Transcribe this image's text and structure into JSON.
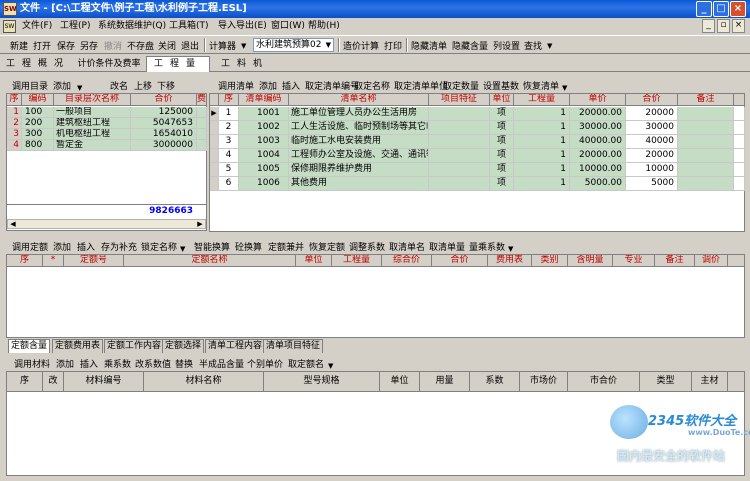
{
  "title": "文件 - [C:\\工程文件\\例子工程\\水利例子工程.ESL]",
  "menu": [
    "文件(F)",
    "工程(P)",
    "系统数据维护(Q)",
    "工具箱(T)",
    "导入导出(E)",
    "窗口(W)",
    "帮助(H)"
  ],
  "toolbar": {
    "items": [
      "新建",
      "打开",
      "保存",
      "另存",
      "撤消",
      "不存盘",
      "关闭",
      "退出",
      "计算器",
      "水利建筑预算02",
      "造价计算",
      "打印",
      "隐藏清单",
      "隐藏含量",
      "列设置",
      "查找"
    ],
    "disabled": [
      "撤消"
    ]
  },
  "tabs": [
    "工程概况",
    "计价条件及费率",
    "工程量",
    "工料机"
  ],
  "active_tab": "工程量",
  "left_toolbar": [
    "调用目录",
    "添加",
    "改名",
    "上移",
    "下移"
  ],
  "left_headers": [
    "序",
    "编码",
    "目录层次名称",
    "合价",
    "费"
  ],
  "left_rows": [
    {
      "seq": "1",
      "code": "100",
      "name": "一般项目",
      "price": "125000"
    },
    {
      "seq": "2",
      "code": "200",
      "name": "建筑枢纽工程",
      "price": "5047653"
    },
    {
      "seq": "3",
      "code": "300",
      "name": "机电枢纽工程",
      "price": "1654010"
    },
    {
      "seq": "4",
      "code": "800",
      "name": "暂定金",
      "price": "3000000"
    }
  ],
  "left_total": "9826663",
  "right_toolbar": [
    "调用清单",
    "添加",
    "插入",
    "取定清单编号",
    "取定名称",
    "取定清单单位",
    "取定数量",
    "设置基数",
    "恢复清单"
  ],
  "right_headers": [
    "序",
    "清单编码",
    "清单名称",
    "项目特征",
    "单位",
    "工程量",
    "单价",
    "合价",
    "备注"
  ],
  "right_rows": [
    {
      "seq": "1",
      "code": "1001",
      "name": "施工单位管理人员办公生活用房",
      "unit": "项",
      "qty": "1",
      "price": "20000.00",
      "total": "20000"
    },
    {
      "seq": "2",
      "code": "1002",
      "name": "工人生活设施、临时预制场等其它临",
      "unit": "项",
      "qty": "1",
      "price": "30000.00",
      "total": "30000"
    },
    {
      "seq": "3",
      "code": "1003",
      "name": "临时施工水电安装费用",
      "unit": "项",
      "qty": "1",
      "price": "40000.00",
      "total": "40000"
    },
    {
      "seq": "4",
      "code": "1004",
      "name": "工程师办公室及设施、交通、通讯等",
      "unit": "项",
      "qty": "1",
      "price": "20000.00",
      "total": "20000"
    },
    {
      "seq": "5",
      "code": "1005",
      "name": "保修期限养维护费用",
      "unit": "项",
      "qty": "1",
      "price": "10000.00",
      "total": "10000"
    },
    {
      "seq": "6",
      "code": "1006",
      "name": "其他费用",
      "unit": "项",
      "qty": "1",
      "price": "5000.00",
      "total": "5000"
    }
  ],
  "mid_toolbar": [
    "调用定额",
    "添加",
    "插入",
    "存为补充",
    "锁定名称",
    "智能换算",
    "砼换算",
    "定额兼并",
    "恢复定额",
    "调整系数",
    "取清单名",
    "取清单量",
    "量乘系数"
  ],
  "mid_headers": [
    "序",
    "*",
    "定额号",
    "定额名称",
    "单位",
    "工程量",
    "综合价",
    "合价",
    "费用表",
    "类别",
    "含明量",
    "专业",
    "备注",
    "调价"
  ],
  "bottom_tabs": [
    "定额含量",
    "定额费用表",
    "定额工作内容",
    "定额选择",
    "清单工程内容",
    "清单项目特征"
  ],
  "active_bottom_tab": "定额含量",
  "bottom_toolbar": [
    "调用材料",
    "添加",
    "插入",
    "乘系数",
    "改系数值",
    "替换",
    "半成品含量",
    "个别单价",
    "取定额名"
  ],
  "bottom_headers": [
    "序",
    "改",
    "材料编号",
    "材料名称",
    "型号规格",
    "单位",
    "用量",
    "系数",
    "市场价",
    "市合价",
    "类型",
    "主材"
  ],
  "watermark": {
    "brand": "2345软件大全",
    "url": "www.DuoTe.com",
    "slogan": "国内最安全的软件站"
  }
}
